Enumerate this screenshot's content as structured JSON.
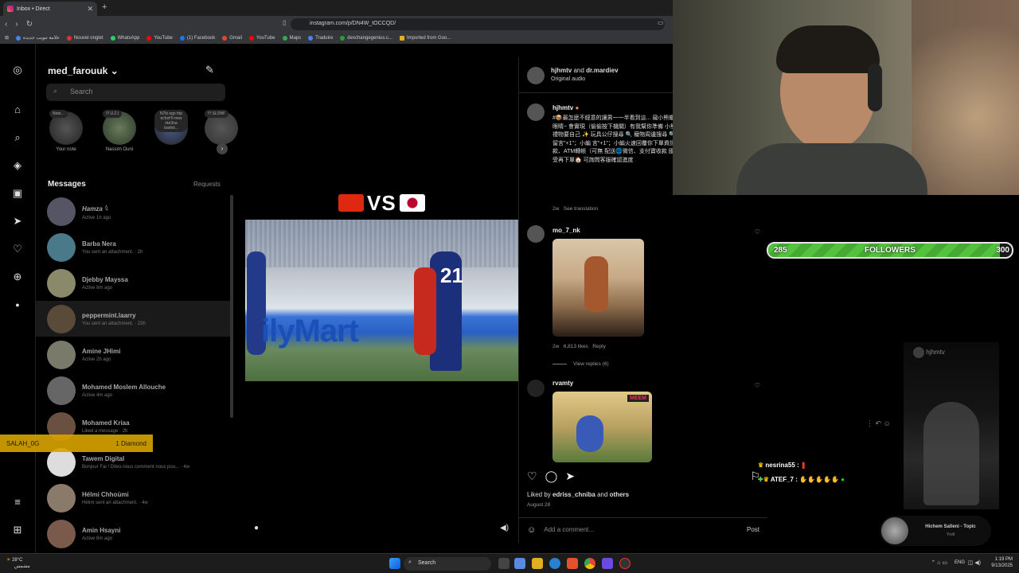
{
  "browser": {
    "tab_title": "Inbox • Direct",
    "url": "instagram.com/p/DN4W_tOCCQD/",
    "bookmarks": [
      "علامة تبويب جديدة",
      "Nouvel onglet",
      "WhatsApp",
      "YouTube",
      "(1) Facebook",
      "Gmail",
      "YouTube",
      "Maps",
      "Traduire",
      "dexchangegenius.c...",
      "Imported from Goo..."
    ]
  },
  "messages": {
    "username": "med_farouuk",
    "search_placeholder": "Search",
    "header": "Messages",
    "requests": "Requests",
    "stories": [
      {
        "note": "Note...",
        "label": "Your note"
      },
      {
        "note": "!!! U.Z.I",
        "label": "Nassim Ouni"
      },
      {
        "note": "N7ki ego trip nchof fi mes nte3na badnii...",
        "label": ""
      },
      {
        "note": "!!! SLOW!",
        "label": ""
      }
    ],
    "chats": [
      {
        "name": "Hamza 𓆩",
        "sub": "Active 1h ago"
      },
      {
        "name": "Barba Nera",
        "sub": "You sent an attachment. · 2h"
      },
      {
        "name": "Djebby Mayssa",
        "sub": "Active 8m ago"
      },
      {
        "name": "peppermint.laarry",
        "sub": "You sent an attachment. · 23h"
      },
      {
        "name": "Amine JHimi",
        "sub": "Active 2h ago"
      },
      {
        "name": "Mohamed Moslem Allouche",
        "sub": "Active 4m ago"
      },
      {
        "name": "Mohamed Kriaa",
        "sub": "Liked a message · 2h"
      },
      {
        "name": "Tawem Digital",
        "sub": "Bonjour Fai ! Dites-nous comment nous pou... · 4w"
      },
      {
        "name": "Hélmi Chhoùmi",
        "sub": "Hélmi sent an attachment. · 4w"
      },
      {
        "name": "Amin Hsayni",
        "sub": "Active 8m ago"
      }
    ]
  },
  "video": {
    "vs_text": "VS"
  },
  "post": {
    "author1": "hjhmtv",
    "and": "and",
    "author2": "dr.mardiev",
    "audio": "Original audio",
    "cap_user": "hjhmtv",
    "caption": "#📦最怎麼不經意的讓男一一半看到這... 窺小熊蠟搖旋轉禮盒🕯️ 喂~閉上眼睛~ 會實現（偷偷按下機關）有我幫你準備 小熊蠟燭盒 沒有附滅蠟🕯️ 禮物要自己 ✨ 玩具公仔搜尋 🔍 寵物周邊搜尋 🔍 精選💬 下單方式📨 💬留言\"+1\"；小編 言\"+1\"；小編火速回覆你下單資訊 可自 方式 台灣地📦匯款、ATM轉帳（可無 配送🌐微信、支付寶收款 國外配送到 可能延誤 能接受再下單🏠 可詢問客服確認進度",
    "cap_time": "2w",
    "see_translation": "See translation",
    "c1_user": "mo_7_nk",
    "c1_time": "2w",
    "c1_likes": "6,813 likes",
    "c1_reply": "Reply",
    "c1_view": "View replies (6)",
    "c2_user": "rvamty",
    "c2_badge": "MEEM",
    "liked_prefix": "Liked by",
    "liked_user": "edriss_chniba",
    "liked_and": "and",
    "liked_others": "others",
    "date": "August 28",
    "add_comment": "Add a comment...",
    "post_btn": "Post"
  },
  "stream": {
    "followers_label": "FOLLOWERS",
    "followers_current": "285",
    "followers_goal": "300",
    "followers_progress": 0.95,
    "alert_user": "SALAH_0G",
    "alert_amount": "1 Diamond",
    "chat1_user": "nesrina55 :",
    "chat2_user": "ATEF_7 :",
    "reel_user": "hjhmtv",
    "music_title": "Hichem Salleni - Topic",
    "music_sub": "Yroll"
  },
  "taskbar": {
    "weather_temp": "28°C",
    "weather_desc": "مشمس",
    "search": "Search",
    "lang": "ENG",
    "time": "1:19 PM",
    "date": "9/13/2025"
  }
}
